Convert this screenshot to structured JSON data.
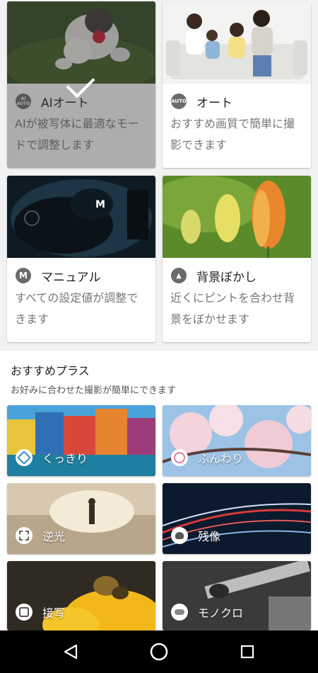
{
  "modes": [
    {
      "id": "ai-auto",
      "icon_text": "AI AUTO",
      "title": "AIオート",
      "desc": "AIが被写体に最適なモードで調整します",
      "selected": true
    },
    {
      "id": "auto",
      "icon_text": "AUTO",
      "title": "オート",
      "desc": "おすすめ画質で簡単に撮影できます",
      "selected": false
    },
    {
      "id": "manual",
      "icon_text": "M",
      "title": "マニュアル",
      "desc": "すべての設定値が調整できます",
      "selected": false
    },
    {
      "id": "bokeh",
      "icon_text": "▲",
      "title": "背景ぼかし",
      "desc": "近くにピントを合わせ背景をぼかせます",
      "selected": false
    }
  ],
  "plus_section": {
    "title": "おすすめプラス",
    "subtitle": "お好みに合わせた撮影が簡単にできます",
    "items": [
      {
        "label": "くっきり",
        "icon": "sharp-icon"
      },
      {
        "label": "ふんわり",
        "icon": "soft-icon"
      },
      {
        "label": "逆光",
        "icon": "backlight-icon"
      },
      {
        "label": "残像",
        "icon": "afterimage-icon"
      },
      {
        "label": "接写",
        "icon": "macro-icon"
      },
      {
        "label": "モノクロ",
        "icon": "monochrome-icon"
      }
    ]
  },
  "colors": {
    "accent": "#6b6b6b",
    "navbar": "#000000"
  }
}
